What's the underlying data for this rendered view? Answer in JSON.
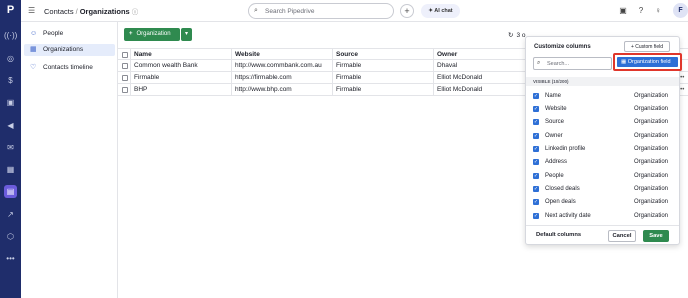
{
  "rail": {
    "logo": "P",
    "icons": [
      "broadcast-icon",
      "target-icon",
      "dollar-icon",
      "clipboard-icon",
      "megaphone-icon",
      "inbox-icon",
      "calendar-icon",
      "contacts-icon",
      "chart-icon",
      "box-icon",
      "more-icon"
    ]
  },
  "topbar": {
    "crumb_parent": "Contacts",
    "crumb_sep": "/",
    "crumb_current": "Organizations",
    "search_placeholder": "Search Pipedrive",
    "ai_chat_label": "AI chat"
  },
  "sidebar": {
    "items": [
      {
        "label": "People",
        "icon": "person-icon"
      },
      {
        "label": "Organizations",
        "icon": "building-icon"
      },
      {
        "label": "Contacts timeline",
        "icon": "timeline-icon"
      }
    ]
  },
  "toolbar": {
    "add_label": "Organization",
    "count_label": "3 o"
  },
  "table": {
    "headers": [
      "Name",
      "Website",
      "Source",
      "Owner"
    ],
    "rows": [
      [
        "Common wealth Bank",
        "http://www.commbank.com.au",
        "Firmable",
        "Dhaval"
      ],
      [
        "Firmable",
        "https://firmable.com",
        "Firmable",
        "Elliot McDonald"
      ],
      [
        "BHP",
        "http://www.bhp.com",
        "Firmable",
        "Elliot McDonald"
      ]
    ]
  },
  "panel": {
    "title": "Customize columns",
    "custom_field_label": "+ Custom field",
    "org_field_label": "Organization field",
    "search_placeholder": "Search...",
    "visible_header": "VISIBLE (10/200)",
    "items": [
      {
        "name": "Name",
        "type": "Organization"
      },
      {
        "name": "Website",
        "type": "Organization"
      },
      {
        "name": "Source",
        "type": "Organization"
      },
      {
        "name": "Owner",
        "type": "Organization"
      },
      {
        "name": "Linkedin profile",
        "type": "Organization"
      },
      {
        "name": "Address",
        "type": "Organization"
      },
      {
        "name": "People",
        "type": "Organization"
      },
      {
        "name": "Closed deals",
        "type": "Organization"
      },
      {
        "name": "Open deals",
        "type": "Organization"
      },
      {
        "name": "Next activity date",
        "type": "Organization"
      }
    ],
    "default_columns_label": "Default columns",
    "cancel_label": "Cancel",
    "save_label": "Save"
  },
  "colors": {
    "rail_bg": "#1f2d6b",
    "accent_green": "#2f8a4f",
    "accent_blue": "#2d6fd6",
    "highlight_red": "#e0362b"
  }
}
